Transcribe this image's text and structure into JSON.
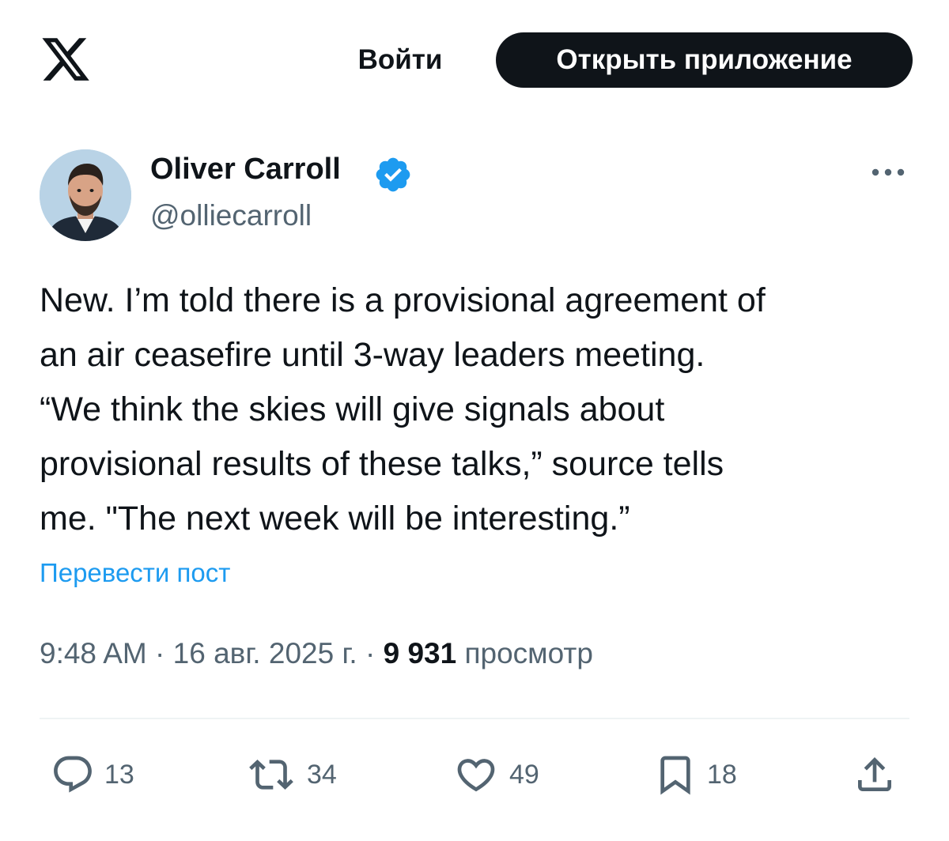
{
  "header": {
    "logo_icon": "x-logo-icon",
    "login_label": "Войти",
    "open_app_label": "Открыть приложение"
  },
  "author": {
    "display_name": "Oliver Carroll",
    "handle": "@olliecarroll",
    "verified_color": "#1d9bf0"
  },
  "tweet": {
    "lines": [
      "New. I’m told there is a provisional agreement of",
      "an air ceasefire until 3-way leaders meeting.",
      "“We think the skies will give signals about",
      "provisional results of these talks,” source tells",
      "me. \"The next week will be interesting.”"
    ],
    "translate_label": "Перевести пост"
  },
  "meta": {
    "time": "9:48 AM",
    "separator": "·",
    "date": "16 авг. 2025 г.",
    "views_count": "9 931",
    "views_label": "просмотр"
  },
  "actions": {
    "replies": "13",
    "reposts": "34",
    "likes": "49",
    "bookmarks": "18"
  },
  "colors": {
    "text_primary": "#0f1419",
    "text_secondary": "#536471",
    "accent": "#1d9bf0",
    "divider": "#eff3f4"
  }
}
